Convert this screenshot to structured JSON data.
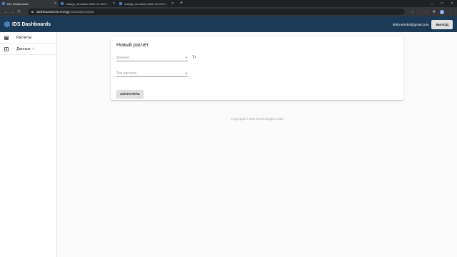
{
  "browser": {
    "tabs": [
      {
        "title": "IDS Dashboards",
        "close": "×"
      },
      {
        "title": "voltage_deviation-2020-12-26T1…",
        "close": "×"
      },
      {
        "title": "voltage_deviation-2020-12-26T1…",
        "close": "×"
      }
    ],
    "new_tab": "+",
    "url_domain": "dashboards.ids.energy",
    "url_path": "/calculations/add",
    "window_controls": [
      "–",
      "□",
      "×"
    ]
  },
  "app": {
    "title": "IDS Dashboards",
    "user_email": "kirill.netreba@gmail.com",
    "logout_label": "ВЫХОД"
  },
  "sidebar": {
    "items": [
      {
        "label": "Расчеты",
        "icon": "calculator-icon"
      },
      {
        "label": "Данные",
        "icon": "data-icon"
      }
    ]
  },
  "form": {
    "title": "Новый расчет",
    "data_placeholder": "Данные",
    "calc_type_placeholder": "Тип расчета",
    "run_label": "ЗАПУСТИТЬ"
  },
  "footer": {
    "copyright": "Copyright © IDS Technologies 2020"
  }
}
